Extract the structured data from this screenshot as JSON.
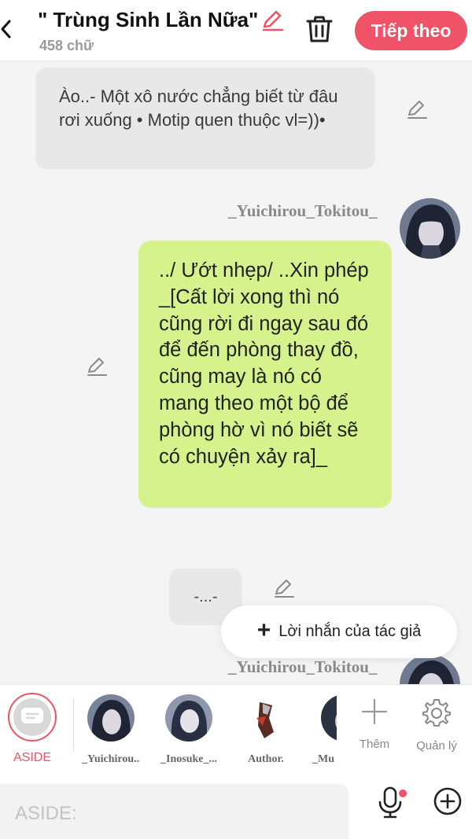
{
  "header": {
    "title": "\" Trùng Sinh Lần Nữa\"",
    "word_count": "458 chữ",
    "next_label": "Tiếp theo"
  },
  "messages": [
    {
      "type": "aside",
      "text": "Ào..- Một xô nước chẳng biết từ đâu rơi xuống • Motip quen thuộc vl=))•"
    },
    {
      "type": "character",
      "speaker": "_Yuichirou_Tokitou_",
      "text": "../ Ướt nhẹp/ ..Xin phép _[Cất lời xong thì nó cũng rời đi ngay sau đó để đến phòng thay đồ, cũng may là nó có mang theo một bộ để phòng hờ vì nó biết sẽ có chuyện xảy ra]_"
    },
    {
      "type": "aside",
      "text": "-...-"
    },
    {
      "type": "character",
      "speaker": "_Yuichirou_Tokitou_",
      "text": ""
    }
  ],
  "author_note_label": "Lời nhắn của tác giả",
  "character_bar": {
    "aside_label": "ASIDE",
    "characters": [
      {
        "label": "_Yuichirou..."
      },
      {
        "label": "_Inosuke_..."
      },
      {
        "label": "Author."
      },
      {
        "label": "_Mu"
      }
    ],
    "add_label": "Thêm",
    "manage_label": "Quản lý"
  },
  "input": {
    "placeholder": "ASIDE:"
  },
  "colors": {
    "accent": "#f05267",
    "bubble_green": "#d6f28d",
    "bubble_gray": "#e8e8e8"
  }
}
